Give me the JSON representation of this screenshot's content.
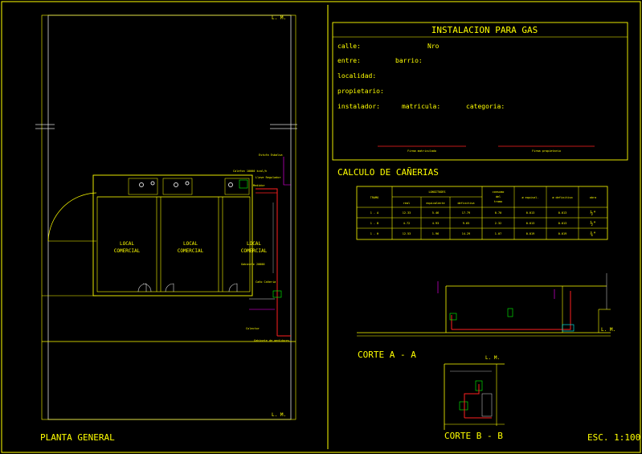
{
  "sheet": {
    "plan_title": "PLANTA GENERAL",
    "scale": "ESC. 1:100",
    "lm_label": "L. M."
  },
  "plan": {
    "rooms": [
      {
        "line1": "LOCAL",
        "line2": "COMERCIAL"
      },
      {
        "line1": "LOCAL",
        "line2": "COMERCIAL"
      },
      {
        "line1": "LOCAL",
        "line2": "COMERCIAL"
      }
    ],
    "notes": [
      "Estufa Esbalsa",
      "Calefon 10000 kcal/h",
      "Llave Regulador",
      "Medidor",
      "Gabinete 20000",
      "Caño Cañeria",
      "Colector",
      "Gabinete de medidores"
    ]
  },
  "title_block": {
    "title": "INSTALACION PARA GAS",
    "fields": {
      "calle": "calle:",
      "nro": "Nro",
      "entre": "entre:",
      "barrio": "barrio:",
      "localidad": "localidad:",
      "propietario": "propietario:",
      "instalador": "instalador:",
      "matricula": "matricula:",
      "categoria": "categoria:"
    },
    "signatures": [
      "Firma matriculado",
      "Firma propietario"
    ]
  },
  "calc": {
    "title": "CALCULO DE CAÑERIAS",
    "headers": {
      "tramo": "TRAMO",
      "longitudes": "LONGITUDES",
      "real": "real",
      "equivalente": "equivalente",
      "definitiva": "definitiva",
      "consumo": [
        "consumo",
        "del",
        "tramo"
      ],
      "d_equival": "ø equival.",
      "d_definitivo": "ø definitivo",
      "obra": "obra"
    },
    "rows": [
      {
        "tramo": "1 - A",
        "real": "12.33",
        "equivalente": "5.46",
        "definitiva": "17.79",
        "consumo": "0.70",
        "d_equival": "0.013",
        "d_definitivo": "0.013",
        "obra": "½\""
      },
      {
        "tramo": "1 - B",
        "real": "4.72",
        "equivalente": "4.93",
        "definitiva": "9.65",
        "consumo": "2.32",
        "d_equival": "0.013",
        "d_definitivo": "0.013",
        "obra": "½\""
      },
      {
        "tramo": "1 - H",
        "real": "12.53",
        "equivalente": "1.96",
        "definitiva": "14.29",
        "consumo": "1.07",
        "d_equival": "0.019",
        "d_definitivo": "0.019",
        "obra": "¾\""
      }
    ]
  },
  "sections": {
    "corte_aa": "CORTE A - A",
    "corte_bb": "CORTE B - B"
  }
}
